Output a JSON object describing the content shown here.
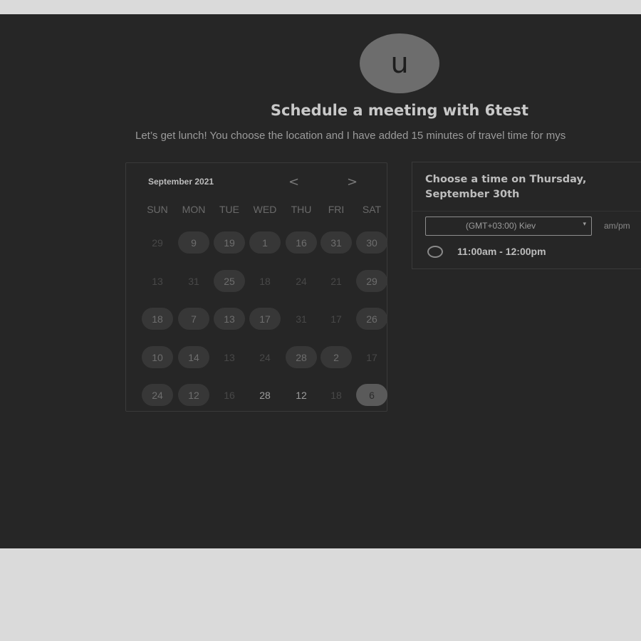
{
  "avatar": {
    "letter": "u"
  },
  "header": {
    "title": "Schedule a meeting with 6test",
    "description": "Let’s get lunch! You choose the location and I have added 15 minutes of travel time for mys"
  },
  "calendar": {
    "month": "September 2021",
    "prev_icon": "chevron-left-icon",
    "next_icon": "chevron-right-icon",
    "prev_glyph": "<",
    "next_glyph": ">",
    "weekdays": [
      "SUN",
      "MON",
      "TUE",
      "WED",
      "THU",
      "FRI",
      "SAT"
    ],
    "weeks": [
      [
        {
          "d": "29",
          "s": "unavailable"
        },
        {
          "d": "9",
          "s": "available"
        },
        {
          "d": "19",
          "s": "available"
        },
        {
          "d": "1",
          "s": "available"
        },
        {
          "d": "16",
          "s": "available"
        },
        {
          "d": "31",
          "s": "available"
        },
        {
          "d": "30",
          "s": "available"
        }
      ],
      [
        {
          "d": "13",
          "s": "unavailable"
        },
        {
          "d": "31",
          "s": "unavailable"
        },
        {
          "d": "25",
          "s": "available"
        },
        {
          "d": "18",
          "s": "unavailable"
        },
        {
          "d": "24",
          "s": "unavailable"
        },
        {
          "d": "21",
          "s": "unavailable"
        },
        {
          "d": "29",
          "s": "available"
        }
      ],
      [
        {
          "d": "18",
          "s": "available"
        },
        {
          "d": "7",
          "s": "available"
        },
        {
          "d": "13",
          "s": "available"
        },
        {
          "d": "17",
          "s": "available"
        },
        {
          "d": "31",
          "s": "unavailable"
        },
        {
          "d": "17",
          "s": "unavailable"
        },
        {
          "d": "26",
          "s": "available"
        }
      ],
      [
        {
          "d": "10",
          "s": "available"
        },
        {
          "d": "14",
          "s": "available"
        },
        {
          "d": "13",
          "s": "unavailable"
        },
        {
          "d": "24",
          "s": "unavailable"
        },
        {
          "d": "28",
          "s": "available"
        },
        {
          "d": "2",
          "s": "available"
        },
        {
          "d": "17",
          "s": "unavailable"
        }
      ],
      [
        {
          "d": "24",
          "s": "available"
        },
        {
          "d": "12",
          "s": "available"
        },
        {
          "d": "16",
          "s": "unavailable"
        },
        {
          "d": "28",
          "s": "bright"
        },
        {
          "d": "12",
          "s": "bright"
        },
        {
          "d": "18",
          "s": "unavailable"
        },
        {
          "d": "6",
          "s": "selected"
        }
      ]
    ]
  },
  "times": {
    "heading": "Choose a time on Thursday, September 30th",
    "timezone": "(GMT+03:00) Kiev",
    "timezone_caret": "▾",
    "format_toggle": "am/pm",
    "slots": [
      {
        "label": "11:00am - 12:00pm",
        "icon": "radio-circle-icon"
      }
    ]
  },
  "colors": {
    "page_background": "#dadada",
    "panel_background": "#262626",
    "available_day_bg": "#373737",
    "selected_day_bg": "#5a5a5a"
  }
}
